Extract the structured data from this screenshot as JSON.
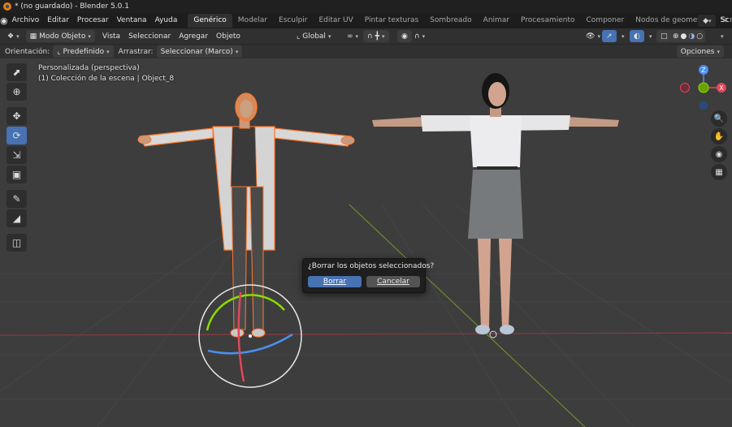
{
  "window": {
    "title": "* (no guardado) - Blender 5.0.1"
  },
  "menu": {
    "items": [
      "Archivo",
      "Editar",
      "Procesar",
      "Ventana",
      "Ayuda"
    ],
    "workspaces": [
      "Genérico",
      "Modelar",
      "Esculpir",
      "Editar UV",
      "Pintar texturas",
      "Sombreado",
      "Animar",
      "Procesamiento",
      "Componer",
      "Nodos de geometría",
      "Scripts"
    ],
    "active_workspace": "Genérico",
    "scene_label": "Sc"
  },
  "header": {
    "mode": "Modo Objeto",
    "menus": [
      "Vista",
      "Seleccionar",
      "Agregar",
      "Objeto"
    ],
    "transform_orientation": "Global"
  },
  "toolsettings": {
    "orientation_label": "Orientación:",
    "orientation_value": "Predefinido",
    "drag_label": "Arrastrar:",
    "drag_value": "Seleccionar (Marco)",
    "options_label": "Opciones"
  },
  "viewport": {
    "view_name": "Personalizada (perspectiva)",
    "collection_info": "(1) Colección de la escena | Object_8",
    "gizmo": {
      "z_label": "Z",
      "x_label": "X"
    }
  },
  "dialog": {
    "question": "¿Borrar los objetos seleccionados?",
    "confirm_label": "Borrar",
    "cancel_label": "Cancelar"
  },
  "colors": {
    "accent": "#4772b3",
    "selection_outline": "#ff7a30",
    "axis_x": "#e2465a",
    "axis_y": "#8bdc00",
    "axis_z": "#4c8ef0"
  }
}
